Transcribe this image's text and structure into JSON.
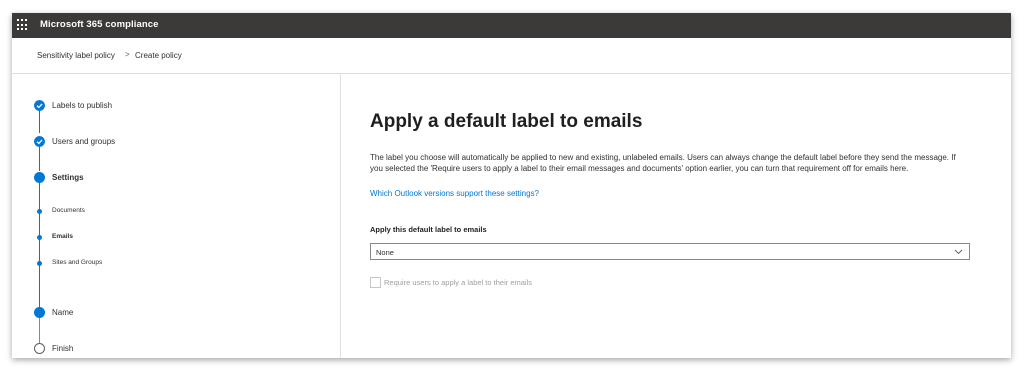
{
  "topbar": {
    "app_title": "Microsoft 365 compliance"
  },
  "breadcrumb": {
    "items": [
      "Sensitivity label policy",
      "Create policy"
    ],
    "separator": ">"
  },
  "wizard": {
    "steps": [
      {
        "label": "Labels to publish",
        "state": "completed"
      },
      {
        "label": "Users and groups",
        "state": "completed"
      },
      {
        "label": "Settings",
        "state": "current"
      },
      {
        "label": "Documents",
        "state": "substep"
      },
      {
        "label": "Emails",
        "state": "substep-current"
      },
      {
        "label": "Sites and Groups",
        "state": "substep"
      },
      {
        "label": "Name",
        "state": "upcoming"
      },
      {
        "label": "Finish",
        "state": "not-started"
      }
    ]
  },
  "main": {
    "title": "Apply a default label to emails",
    "description": "The label you choose will automatically be applied to new and existing, unlabeled emails. Users can always change the default label before they send the message. If you selected the 'Require users to apply a label to their email messages and documents' option earlier, you can turn that requirement off for emails here.",
    "link": "Which Outlook versions support these settings?",
    "field_label": "Apply this default label to emails",
    "dropdown_value": "None",
    "checkbox_label": "Require users to apply a label to their emails",
    "checkbox_checked": false
  },
  "colors": {
    "accent": "#0078d4",
    "topbar": "#3b3a39",
    "disabled_text": "#a19f9d"
  },
  "icons": {
    "app_launcher": "waffle-icon",
    "completed": "checkmark-circle-icon",
    "dropdown": "chevron-down-icon"
  }
}
